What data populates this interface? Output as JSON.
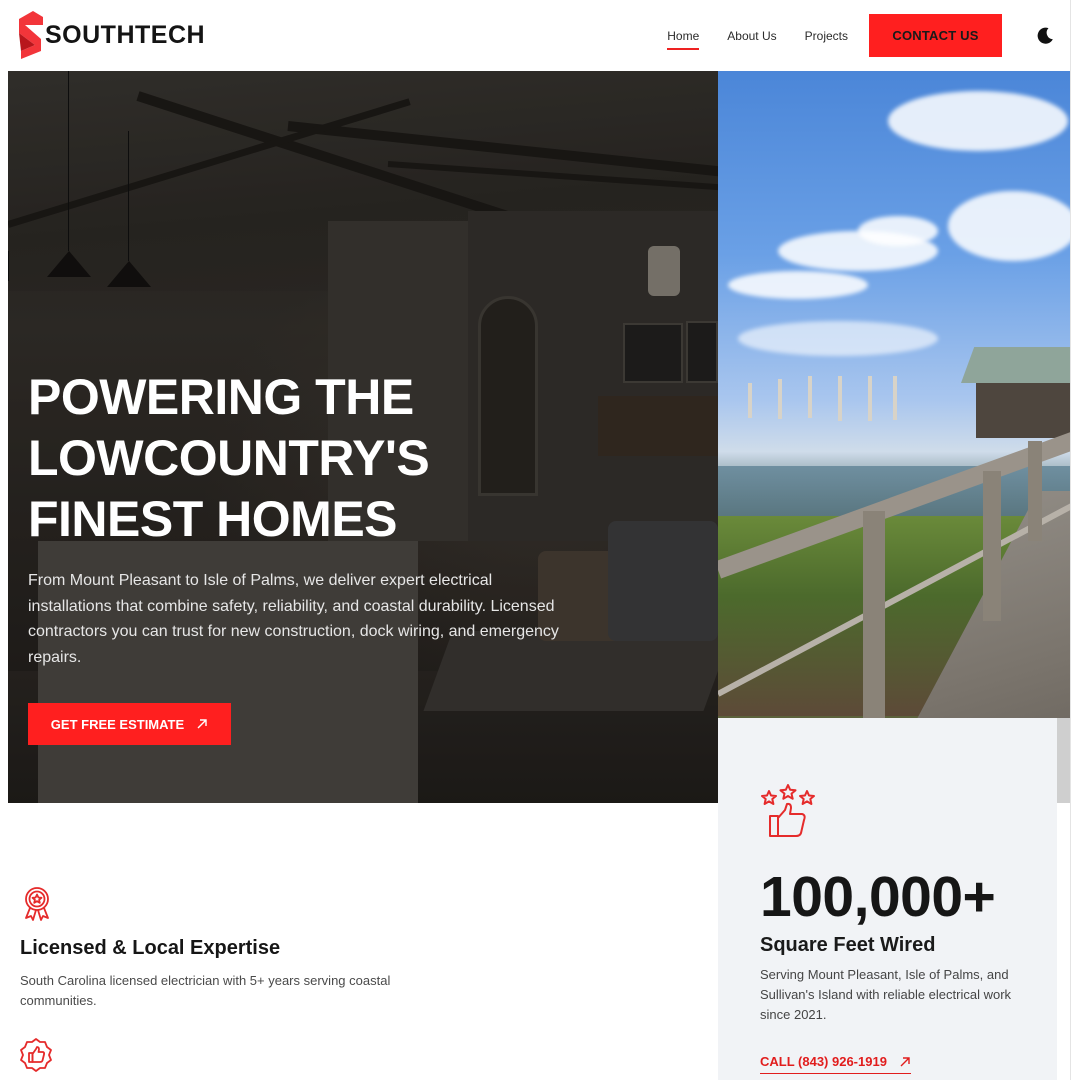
{
  "brand": {
    "name": "SOUTHTECH",
    "accent_color": "#ff1f1f",
    "logo_icon": "southtech-s-logo-icon"
  },
  "nav": {
    "items": [
      {
        "label": "Home",
        "active": true
      },
      {
        "label": "About Us",
        "active": false
      },
      {
        "label": "Projects",
        "active": false
      }
    ],
    "contact_label": "CONTACT US",
    "theme_icon": "moon-icon"
  },
  "hero": {
    "title_lines": [
      "POWERING THE",
      "LOWCOUNTRY'S",
      "FINEST HOMES"
    ],
    "description": "From Mount Pleasant to Isle of Palms, we deliver expert electrical installations that combine safety, reliability, and coastal durability. Licensed contractors you can trust for new construction, dock wiring, and emergency repairs.",
    "cta_label": "GET FREE ESTIMATE",
    "cta_icon": "arrow-up-right-icon"
  },
  "stats": {
    "icon": "stars-thumbs-up-icon",
    "number": "100,000+",
    "label": "Square Feet Wired",
    "description": "Serving Mount Pleasant, Isle of Palms, and Sullivan's Island with reliable electrical work since 2021.",
    "call_label": "CALL (843) 926-1919",
    "call_icon": "arrow-up-right-icon"
  },
  "features": [
    {
      "icon": "award-ribbon-icon",
      "title": "Licensed & Local Expertise",
      "description": "South Carolina licensed electrician with 5+ years serving coastal communities."
    },
    {
      "icon": "thumbs-up-badge-icon"
    }
  ]
}
